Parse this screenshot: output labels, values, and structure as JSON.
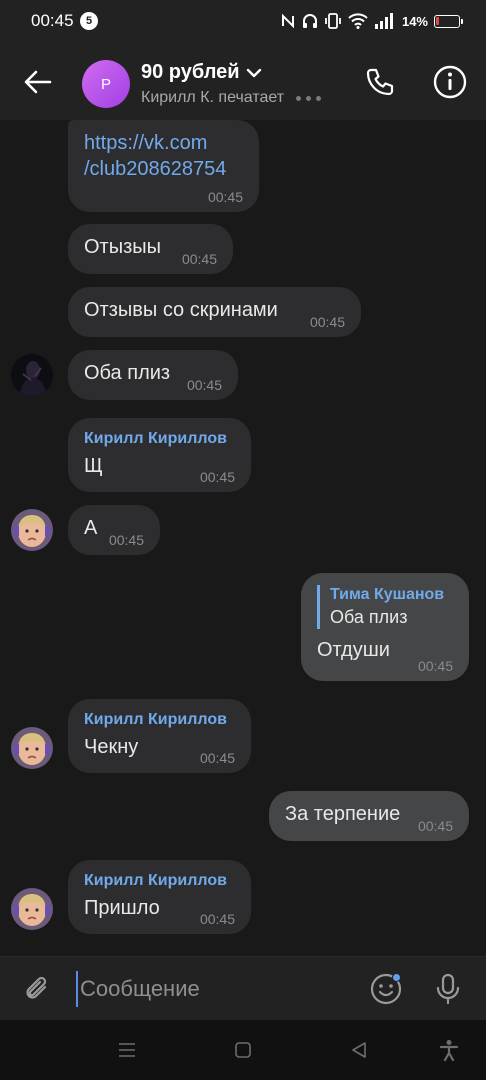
{
  "status_bar": {
    "time": "00:45",
    "notification_count": "5",
    "battery_percent": "14%",
    "battery_level": 0.14,
    "battery_color": "#e64646"
  },
  "header": {
    "avatar_letter": "Р",
    "title": "90 рублей",
    "subtitle": "Кирилл К. печатает",
    "accent": "#a23fe3"
  },
  "messages": [
    {
      "type": "link",
      "text_line1": "https://vk.com",
      "text_line2": "/club208628754",
      "time": "00:45"
    },
    {
      "text": "Отызыы",
      "time": "00:45"
    },
    {
      "text": "Отзывы со скринами",
      "time": "00:45"
    },
    {
      "text": "Оба плиз",
      "time": "00:45"
    },
    {
      "sender": "Кирилл Кириллов",
      "text": "Щ",
      "time": "00:45"
    },
    {
      "text": "А",
      "time": "00:45"
    },
    {
      "outgoing": true,
      "reply_to": {
        "name": "Тима Кушанов",
        "text": "Оба плиз"
      },
      "text": "Отдуши",
      "time": "00:45"
    },
    {
      "sender": "Кирилл Кириллов",
      "text": "Чекну",
      "time": "00:45"
    },
    {
      "outgoing": true,
      "text": "За терпение",
      "time": "00:45"
    },
    {
      "sender": "Кирилл Кириллов",
      "text": "Пришло",
      "time": "00:45"
    }
  ],
  "composer": {
    "placeholder": "Сообщение"
  },
  "icons": {
    "back": "arrow-left-icon",
    "call": "phone-icon",
    "info": "info-icon",
    "attach": "paperclip-icon",
    "emoji": "smile-icon",
    "mic": "microphone-icon"
  },
  "colors": {
    "link": "#71aaeb",
    "incoming_bubble": "#2d2d2f",
    "outgoing_bubble": "#454647",
    "background": "#191919"
  }
}
